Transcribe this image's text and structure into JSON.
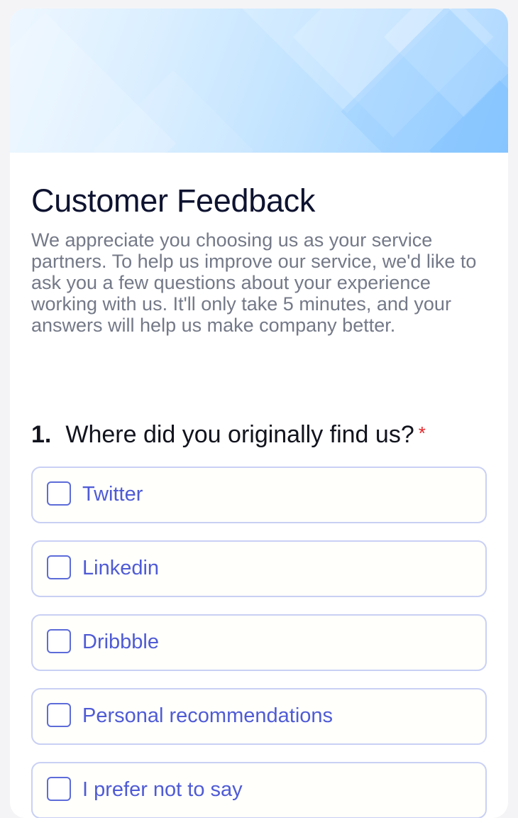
{
  "form": {
    "title": "Customer Feedback",
    "description": "We appreciate you choosing us as your service partners. To help us improve our service, we'd like to ask you a few questions about your experience working with us. It'll only take 5 minutes, and your answers will help us make company better."
  },
  "question": {
    "number": "1.",
    "text": "Where did you originally find us?",
    "required_marker": "*",
    "options": [
      {
        "label": "Twitter",
        "checked": false
      },
      {
        "label": "Linkedin",
        "checked": false
      },
      {
        "label": "Dribbble",
        "checked": false
      },
      {
        "label": "Personal recommendations",
        "checked": false
      },
      {
        "label": "I prefer not to say",
        "checked": false
      }
    ]
  },
  "colors": {
    "accent": "#4f5bd5",
    "required": "#e8262a",
    "option_border": "#c9d0f4",
    "title": "#0e1330",
    "description": "#747988"
  }
}
